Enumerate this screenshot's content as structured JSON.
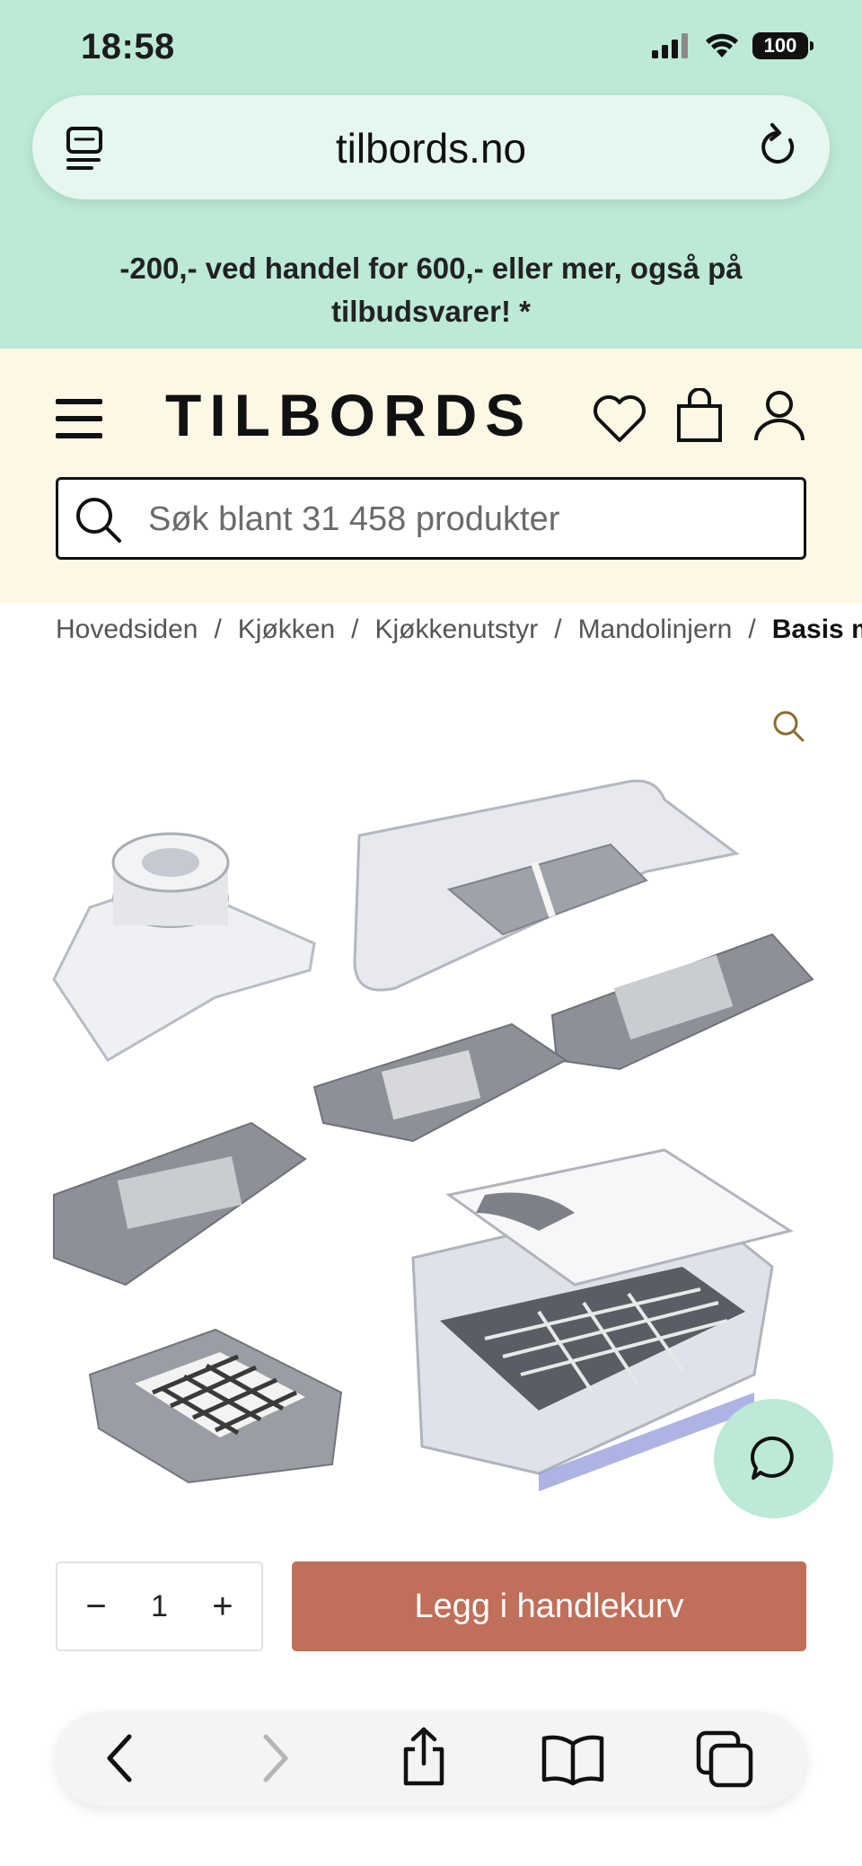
{
  "status_bar": {
    "time": "18:58",
    "battery": "100"
  },
  "browser": {
    "url": "tilbords.no"
  },
  "promo": {
    "text": "-200,- ved handel for 600,- eller mer, også på tilbudsvarer! *"
  },
  "header": {
    "logo": "TILBORDS",
    "search_placeholder": "Søk blant 31 458 produkter"
  },
  "breadcrumb": {
    "items": [
      "Hovedsiden",
      "Kjøkken",
      "Kjøkkenutstyr",
      "Mandolinjern"
    ],
    "current": "Basis ma",
    "separator": "/"
  },
  "product": {
    "quantity": "1",
    "minus": "−",
    "plus": "+",
    "add_to_cart": "Legg i handlekurv"
  },
  "colors": {
    "mint": "#bde9d7",
    "cream": "#fdf7e5",
    "cta": "#c06f5b"
  },
  "icons": [
    "reader-icon",
    "reload-icon",
    "menu-icon",
    "heart-icon",
    "bag-icon",
    "user-icon",
    "search-icon",
    "zoom-icon",
    "chat-icon",
    "back-icon",
    "forward-icon",
    "share-icon",
    "bookmarks-icon",
    "tabs-icon"
  ]
}
